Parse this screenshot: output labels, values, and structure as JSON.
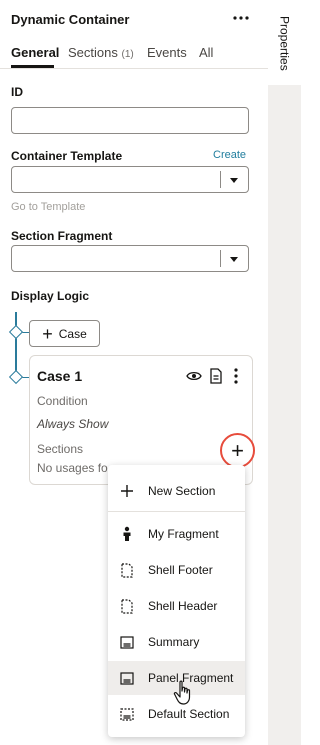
{
  "panel": {
    "title": "Dynamic Container",
    "more_icon": "more-horizontal-icon",
    "tabs": [
      {
        "label": "General",
        "active": true
      },
      {
        "label": "Sections",
        "count": "(1)"
      },
      {
        "label": "Events"
      },
      {
        "label": "All"
      }
    ]
  },
  "rail": {
    "label": "Properties"
  },
  "fields": {
    "id": {
      "label": "ID",
      "value": ""
    },
    "container_template": {
      "label": "Container Template",
      "create_link": "Create",
      "value": "",
      "go_to": "Go to Template"
    },
    "section_fragment": {
      "label": "Section Fragment",
      "value": ""
    },
    "display_logic": {
      "label": "Display Logic"
    }
  },
  "case_button": {
    "label": "Case"
  },
  "case_card": {
    "title": "Case 1",
    "icons": [
      "eye-icon",
      "document-icon",
      "more-vertical-icon"
    ],
    "condition_label": "Condition",
    "condition_value": "Always Show",
    "sections_label": "Sections",
    "sections_value": "No usages fo"
  },
  "menu": {
    "items": [
      {
        "label": "New Section",
        "icon": "plus-icon"
      },
      {
        "label": "My Fragment",
        "icon": "person-icon"
      },
      {
        "label": "Shell Footer",
        "icon": "page-icon"
      },
      {
        "label": "Shell Header",
        "icon": "page-icon"
      },
      {
        "label": "Summary",
        "icon": "panel-icon"
      },
      {
        "label": "Panel Fragment",
        "icon": "panel-icon",
        "hovered": true
      },
      {
        "label": "Default Section",
        "icon": "dashed-panel-icon"
      }
    ]
  },
  "colors": {
    "accent": "#227e9e",
    "highlight_circle": "#e74c3c",
    "tree": "#2a7b9b"
  }
}
